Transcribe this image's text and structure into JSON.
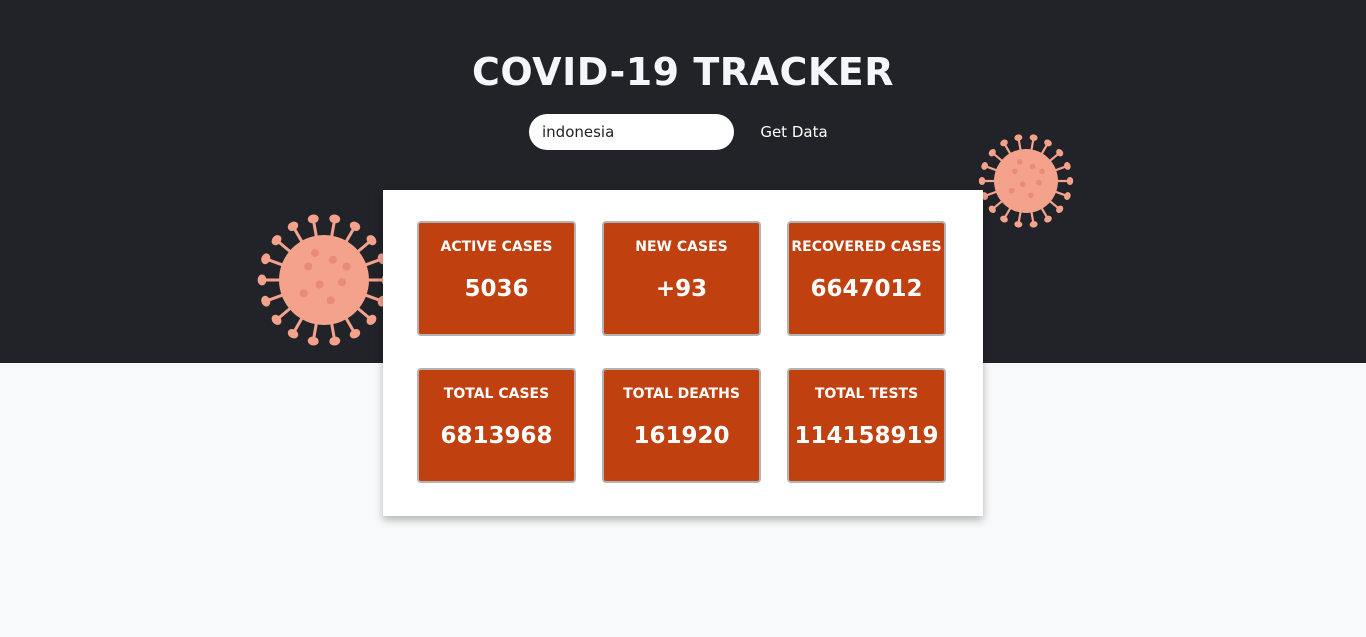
{
  "header": {
    "title": "COVID-19 TRACKER"
  },
  "search": {
    "value": "indonesia",
    "placeholder": ""
  },
  "get_data_label": "Get Data",
  "stats": [
    {
      "label": "ACTIVE CASES",
      "value": "5036"
    },
    {
      "label": "NEW CASES",
      "value": "+93"
    },
    {
      "label": "RECOVERED CASES",
      "value": "6647012"
    },
    {
      "label": "TOTAL CASES",
      "value": "6813968"
    },
    {
      "label": "TOTAL DEATHS",
      "value": "161920"
    },
    {
      "label": "TOTAL TESTS",
      "value": "114158919"
    }
  ],
  "colors": {
    "header_bg": "#212329",
    "page_bg": "#f8f9fa",
    "card_bg": "#c0400f",
    "virus": "#f4a28c"
  },
  "icons": [
    "virus-icon"
  ]
}
